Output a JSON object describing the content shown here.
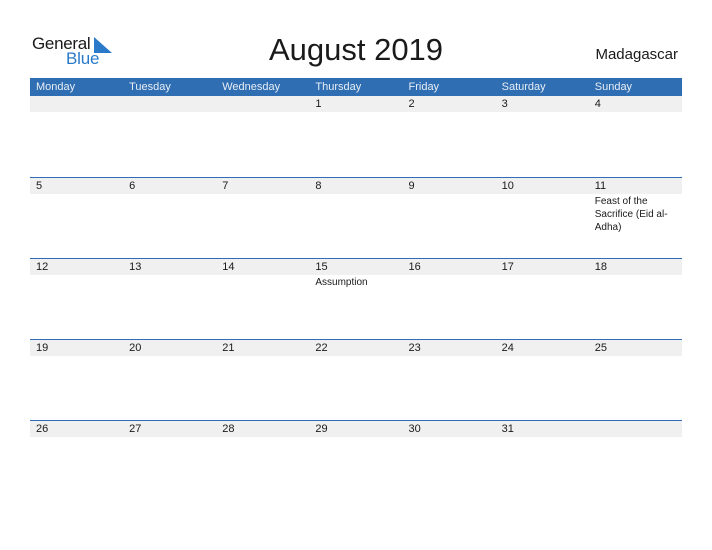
{
  "logo": {
    "word1": "General",
    "word2": "Blue"
  },
  "title": "August 2019",
  "country": "Madagascar",
  "colors": {
    "header": "#2f6eb2",
    "accent": "#2a7ac9",
    "band": "#f0f0f0"
  },
  "weekdays": [
    "Monday",
    "Tuesday",
    "Wednesday",
    "Thursday",
    "Friday",
    "Saturday",
    "Sunday"
  ],
  "weeks": [
    {
      "days": [
        {
          "d": ""
        },
        {
          "d": ""
        },
        {
          "d": ""
        },
        {
          "d": "1"
        },
        {
          "d": "2"
        },
        {
          "d": "3"
        },
        {
          "d": "4"
        }
      ]
    },
    {
      "days": [
        {
          "d": "5"
        },
        {
          "d": "6"
        },
        {
          "d": "7"
        },
        {
          "d": "8"
        },
        {
          "d": "9"
        },
        {
          "d": "10"
        },
        {
          "d": "11",
          "e": "Feast of the Sacrifice (Eid al-Adha)"
        }
      ]
    },
    {
      "days": [
        {
          "d": "12"
        },
        {
          "d": "13"
        },
        {
          "d": "14"
        },
        {
          "d": "15",
          "e": "Assumption"
        },
        {
          "d": "16"
        },
        {
          "d": "17"
        },
        {
          "d": "18"
        }
      ]
    },
    {
      "days": [
        {
          "d": "19"
        },
        {
          "d": "20"
        },
        {
          "d": "21"
        },
        {
          "d": "22"
        },
        {
          "d": "23"
        },
        {
          "d": "24"
        },
        {
          "d": "25"
        }
      ]
    },
    {
      "days": [
        {
          "d": "26"
        },
        {
          "d": "27"
        },
        {
          "d": "28"
        },
        {
          "d": "29"
        },
        {
          "d": "30"
        },
        {
          "d": "31"
        },
        {
          "d": ""
        }
      ]
    }
  ]
}
